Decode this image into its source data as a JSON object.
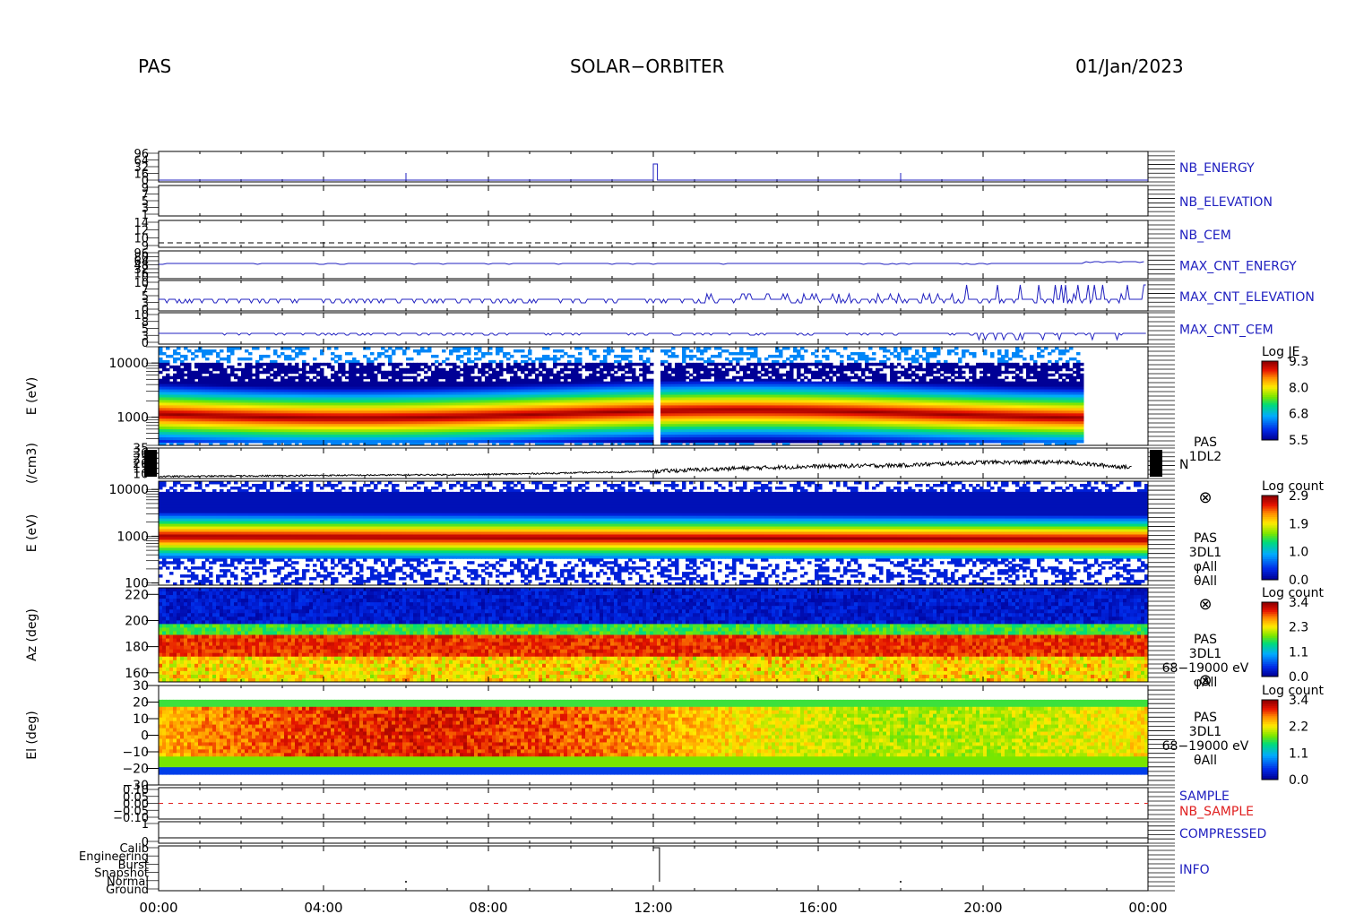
{
  "header": {
    "instrument": "PAS",
    "mission": "SOLAR−ORBITER",
    "date": "01/Jan/2023"
  },
  "colors": {
    "line_blue": "#2020c0",
    "text_blue": "#2020c0",
    "nb_sample_red": "#e02020",
    "background": "#ffffff"
  },
  "chart_data": [
    {
      "type": "line",
      "panel": "nb_energy",
      "label": "NB_ENERGY",
      "ytick_labels": [
        "96",
        "64",
        "32",
        "16",
        "0"
      ],
      "series": [
        {
          "x": [
            "00:00",
            "06:00",
            "12:00",
            "12:10",
            "18:00",
            "24:00"
          ],
          "values": [
            10,
            10,
            10,
            10,
            10,
            10
          ]
        }
      ]
    },
    {
      "type": "line",
      "panel": "nb_elevation",
      "label": "NB_ELEVATION",
      "ytick_labels": [
        "9",
        "7",
        "5",
        "3",
        "1"
      ]
    },
    {
      "type": "line",
      "panel": "nb_cem",
      "label": "NB_CEM",
      "ytick_labels": [
        "14",
        "12",
        "10",
        "9"
      ]
    },
    {
      "type": "line",
      "panel": "max_cnt_energy",
      "label": "MAX_CNT_ENERGY",
      "ytick_labels": [
        "96",
        "80",
        "64",
        "48",
        "32",
        "16",
        "0"
      ]
    },
    {
      "type": "line",
      "panel": "max_cnt_elevation",
      "label": "MAX_CNT_ELEVATION",
      "ytick_labels": [
        "10",
        "7",
        "5",
        "3",
        "0"
      ]
    },
    {
      "type": "line",
      "panel": "max_cnt_cem",
      "label": "MAX_CNT_CEM",
      "ytick_labels": [
        "10",
        "8",
        "5",
        "3",
        "0"
      ]
    },
    {
      "type": "heatmap",
      "panel": "energy_spectrogram_je",
      "ylabel": "E (eV)",
      "yscale": "log",
      "ylim": [
        300,
        20000
      ],
      "ytick_labels": [
        "10000",
        "1000"
      ],
      "colorbar": {
        "title": "Log JE",
        "ticks": [
          "9.3",
          "8.0",
          "6.8",
          "5.5"
        ]
      }
    },
    {
      "type": "line",
      "panel": "density",
      "ylabel": "(/cm3)",
      "ylim": [
        5,
        35
      ],
      "ytick_labels": [
        "35",
        "30",
        "25",
        "20",
        "15",
        "10"
      ],
      "side_label": [
        "PAS",
        "1DL2"
      ],
      "right_label": "N",
      "series": [
        {
          "x": [
            "00:00",
            "04:00",
            "08:00",
            "12:00",
            "14:00",
            "16:00",
            "18:00",
            "20:00",
            "22:00",
            "23:30"
          ],
          "values": [
            7,
            8,
            9,
            12,
            15,
            17,
            18,
            21,
            21,
            16
          ]
        }
      ]
    },
    {
      "type": "heatmap",
      "panel": "energy_spectrogram_count",
      "ylabel": "E (eV)",
      "yscale": "log",
      "ylim": [
        90,
        15000
      ],
      "ytick_labels": [
        "10000",
        "1000",
        "100"
      ],
      "colorbar": {
        "title": "Log count",
        "ticks": [
          "2.9",
          "1.9",
          "1.0",
          "0.0"
        ]
      },
      "side_label": [
        "PAS",
        "3DL1",
        "φAll",
        "θAll"
      ]
    },
    {
      "type": "heatmap",
      "panel": "azimuth",
      "ylabel": "Az (deg)",
      "ylim": [
        153,
        225
      ],
      "ytick_labels": [
        "220",
        "200",
        "180",
        "160"
      ],
      "colorbar": {
        "title": "Log count",
        "ticks": [
          "3.4",
          "2.3",
          "1.1",
          "0.0"
        ]
      },
      "side_label": [
        "PAS",
        "3DL1",
        "68−19000 eV",
        "φAll"
      ]
    },
    {
      "type": "heatmap",
      "panel": "elevation",
      "ylabel": "El (deg)",
      "ylim": [
        -30,
        30
      ],
      "ytick_labels": [
        "30",
        "20",
        "10",
        "0",
        "−10",
        "−20",
        "−30"
      ],
      "colorbar": {
        "title": "Log count",
        "ticks": [
          "3.4",
          "2.2",
          "1.1",
          "0.0"
        ]
      },
      "side_label": [
        "PAS",
        "3DL1",
        "68−19000 eV",
        "θAll"
      ]
    },
    {
      "type": "line",
      "panel": "sample",
      "labels": [
        "SAMPLE",
        "NB_SAMPLE"
      ],
      "ytick_labels": [
        "0.10",
        "0.05",
        "0.00",
        "−0.05",
        "−0.10"
      ]
    },
    {
      "type": "line",
      "panel": "compressed",
      "label": "COMPRESSED",
      "ytick_labels": [
        "1",
        "0"
      ]
    },
    {
      "type": "line",
      "panel": "info",
      "label": "INFO",
      "ytick_labels": [
        "Calib",
        "Engineering",
        "Burst",
        "Snapshot",
        "Normal",
        "Ground"
      ]
    }
  ],
  "x_axis": {
    "ticks": [
      "00:00",
      "04:00",
      "08:00",
      "12:00",
      "16:00",
      "20:00",
      "00:00"
    ]
  }
}
